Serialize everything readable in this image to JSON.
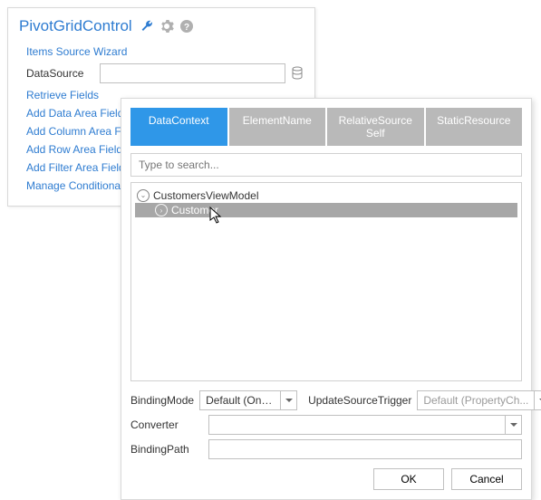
{
  "taskPanel": {
    "title": "PivotGridControl",
    "links": {
      "itemsSourceWizard": "Items Source Wizard",
      "retrieveFields": "Retrieve Fields",
      "addDataArea": "Add Data Area Field",
      "addColumnArea": "Add Column Area Field",
      "addRowArea": "Add Row Area Field",
      "addFilterArea": "Add Filter Area Field",
      "manageConditions": "Manage Conditional Formatting Rules"
    },
    "dataSourceLabel": "DataSource",
    "dataSourceValue": ""
  },
  "popup": {
    "tabs": {
      "dataContext": "DataContext",
      "elementName": "ElementName",
      "relativeSourceSelf": "RelativeSource Self",
      "staticResource": "StaticResource"
    },
    "activeTab": "dataContext",
    "searchPlaceholder": "Type to search...",
    "tree": {
      "root": "CustomersViewModel",
      "child": "Customer"
    },
    "form": {
      "bindingModeLabel": "BindingMode",
      "bindingModeValue": "Default (One...",
      "updateSourceTriggerLabel": "UpdateSourceTrigger",
      "updateSourceTriggerValue": "Default (PropertyCh...",
      "converterLabel": "Converter",
      "converterValue": "",
      "bindingPathLabel": "BindingPath",
      "bindingPathValue": ""
    },
    "buttons": {
      "ok": "OK",
      "cancel": "Cancel"
    }
  }
}
